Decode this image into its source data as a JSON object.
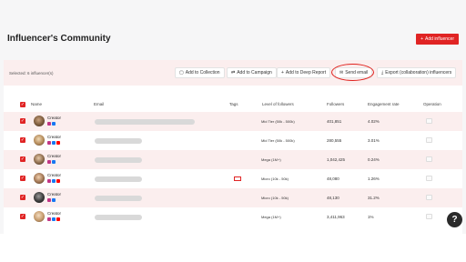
{
  "page": {
    "title": "Influencer's Community",
    "add_button": "Add influencer"
  },
  "selection": {
    "summary": "Selected: 6 influencer(s)",
    "actions": {
      "add_to_collection": "Add to Collection",
      "add_to_campaign": "Add to Campaign",
      "add_to_deep_report": "Add to Deep Report",
      "send_email": "Send email",
      "export": "Export (collaboration) influencers"
    }
  },
  "table": {
    "headers": {
      "name": "Name",
      "email": "Email",
      "tags": "Tags",
      "level": "Level of followers",
      "followers": "Followers",
      "engagement": "Engagement rate",
      "operation": "Operation"
    },
    "rows": [
      {
        "name": "Creator",
        "level": "Mid Tier (50k - 500k)",
        "followers": "401,851",
        "engagement": "4.02%",
        "tag": "",
        "socials": [
          "instagram",
          "facebook"
        ]
      },
      {
        "name": "Creator",
        "level": "Mid Tier (50k - 500k)",
        "followers": "280,555",
        "engagement": "3.01%",
        "tag": "",
        "socials": [
          "instagram",
          "facebook",
          "youtube"
        ]
      },
      {
        "name": "Creator",
        "level": "Mega (1M+)",
        "followers": "1,042,425",
        "engagement": "0.24%",
        "tag": "",
        "socials": [
          "instagram",
          "facebook"
        ]
      },
      {
        "name": "Creator",
        "level": "Micro (10k - 50k)",
        "followers": "48,080",
        "engagement": "1.26%",
        "tag": "",
        "socials": [
          "instagram",
          "facebook",
          "youtube"
        ]
      },
      {
        "name": "Creator",
        "level": "Micro (10k - 50k)",
        "followers": "48,130",
        "engagement": "31.2%",
        "tag": "",
        "socials": [
          "instagram",
          "facebook"
        ]
      },
      {
        "name": "Creator",
        "level": "Mega (1M+)",
        "followers": "3,411,963",
        "engagement": "1%",
        "tag": "",
        "socials": [
          "instagram",
          "facebook",
          "youtube"
        ]
      }
    ]
  },
  "colors": {
    "accent": "#e02424",
    "row_highlight": "#fbeeee",
    "instagram": "#c13584",
    "facebook": "#1877f2",
    "youtube": "#ff0000"
  },
  "icons": {
    "add": "plus-icon",
    "collection": "collection-icon",
    "campaign": "campaign-icon",
    "deep_report": "plus-icon",
    "email": "envelope-icon",
    "export": "download-icon",
    "help": "question-icon"
  },
  "help_label": "?"
}
